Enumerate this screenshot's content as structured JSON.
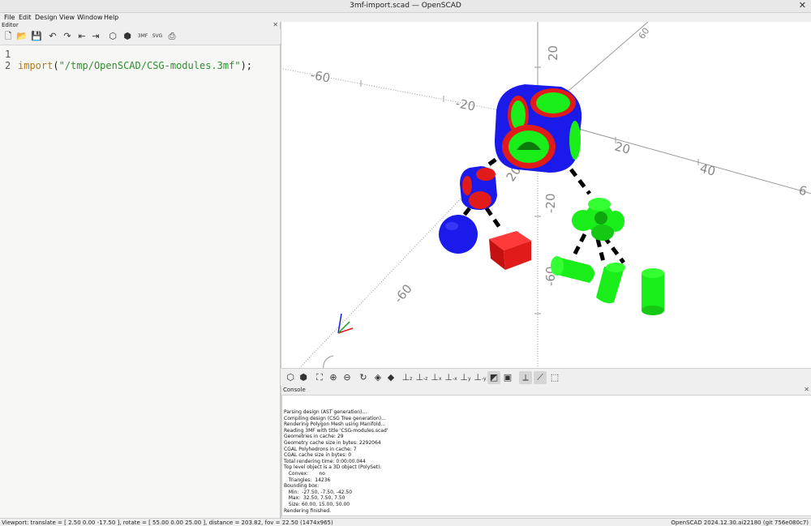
{
  "window": {
    "title": "3mf-import.scad — OpenSCAD"
  },
  "menu": {
    "file": "File",
    "edit": "Edit",
    "design": "Design",
    "view": "View",
    "window": "Window",
    "help": "Help"
  },
  "editor": {
    "panel_label": "Editor",
    "line_numbers": [
      "1",
      "2"
    ],
    "code": {
      "keyword": "import",
      "open_paren": "(",
      "string": "\"/tmp/OpenSCAD/CSG-modules.3mf\"",
      "close": ");"
    },
    "toolbar_icons": [
      "new-file-icon",
      "open-file-icon",
      "save-file-icon",
      "undo-icon",
      "redo-icon",
      "unindent-icon",
      "indent-icon",
      "preview-icon",
      "render-icon",
      "export-3mf-icon",
      "export-svg-icon",
      "send-to-print-icon"
    ]
  },
  "viewport": {
    "axis_labels": {
      "y_top_20": "20",
      "y_top_60": "60",
      "x_neg_60": "-60",
      "x_neg_20": "-20",
      "x_pos_20": "20",
      "x_pos_40": "40",
      "x_pos_6": "6",
      "z_neg_20": "-20",
      "z_neg_60": "-60",
      "y_mid_20": "20",
      "y_neg_60": "-60"
    },
    "colors": {
      "blue": "#1a1aeb",
      "red": "#e11a1a",
      "green": "#1aee1a",
      "edge": "#000000"
    }
  },
  "view_toolbar": {
    "icons": [
      "preview-icon",
      "render-icon",
      "view-all-icon",
      "zoom-in-icon",
      "zoom-out-icon",
      "reset-view-icon",
      "perspective-icon",
      "orthogonal-icon",
      "view-right-icon",
      "view-top-icon",
      "view-bottom-icon",
      "view-left-icon",
      "view-front-icon",
      "view-back-icon",
      "show-edges-icon",
      "show-axes-icon",
      "show-scale-icon",
      "show-crosshairs-icon"
    ],
    "labels": {
      "top": "z",
      "bottom": "-z",
      "left": "x",
      "right": "-x",
      "front": "y",
      "back": "-y"
    }
  },
  "console": {
    "panel_label": "Console",
    "lines": [
      "Parsing design (AST generation)...",
      "Compiling design (CSG Tree generation)...",
      "Rendering Polygon Mesh using Manifold...",
      "Reading 3MF with title 'CSG-modules.scad'",
      "Geometries in cache: 29",
      "Geometry cache size in bytes: 2292064",
      "CGAL Polyhedrons in cache: 7",
      "CGAL cache size in bytes: 0",
      "Total rendering time: 0:00:00.044",
      "Top level object is a 3D object (PolySet):",
      "   Convex:       no",
      "   Triangles:  14236",
      "Bounding box:",
      "   Min:  -27.50, -7.50, -42.50",
      "   Max:  32.50, 7.50, 7.50",
      "   Size: 60.00, 15.00, 50.00",
      "Rendering finished."
    ]
  },
  "status": {
    "viewport": "Viewport: translate = [ 2.50 0.00 -17.50 ], rotate = [ 55.00 0.00 25.00 ], distance = 203.82, fov = 22.50 (1474x965)",
    "version": "OpenSCAD 2024.12.30.ai22180 (git 756e080c7)"
  }
}
